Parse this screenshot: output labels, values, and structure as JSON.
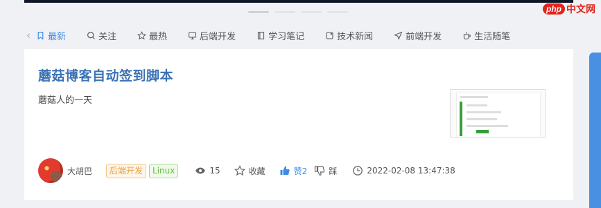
{
  "brand": {
    "logo_text": "php",
    "name": "中文网"
  },
  "nav": {
    "items": [
      {
        "label": "最新",
        "icon": "bookmark-icon",
        "active": true
      },
      {
        "label": "关注",
        "icon": "search-icon"
      },
      {
        "label": "最热",
        "icon": "star-icon"
      },
      {
        "label": "后端开发",
        "icon": "monitor-icon"
      },
      {
        "label": "学习笔记",
        "icon": "notebook-icon"
      },
      {
        "label": "技术新闻",
        "icon": "news-icon"
      },
      {
        "label": "前端开发",
        "icon": "send-icon"
      },
      {
        "label": "生活随笔",
        "icon": "cup-icon"
      }
    ]
  },
  "article": {
    "title": "蘑菇博客自动签到脚本",
    "summary": "蘑菇人的一天",
    "author": "大胡巴",
    "tags": [
      "后端开发",
      "Linux"
    ],
    "views": "15",
    "collect_label": "收藏",
    "like_label": "赞2",
    "dislike_label": "踩",
    "date": "2022-02-08 13:47:38"
  },
  "colors": {
    "accent": "#3d8be3",
    "title": "#3b72b5",
    "brand_red": "#e2231a"
  }
}
